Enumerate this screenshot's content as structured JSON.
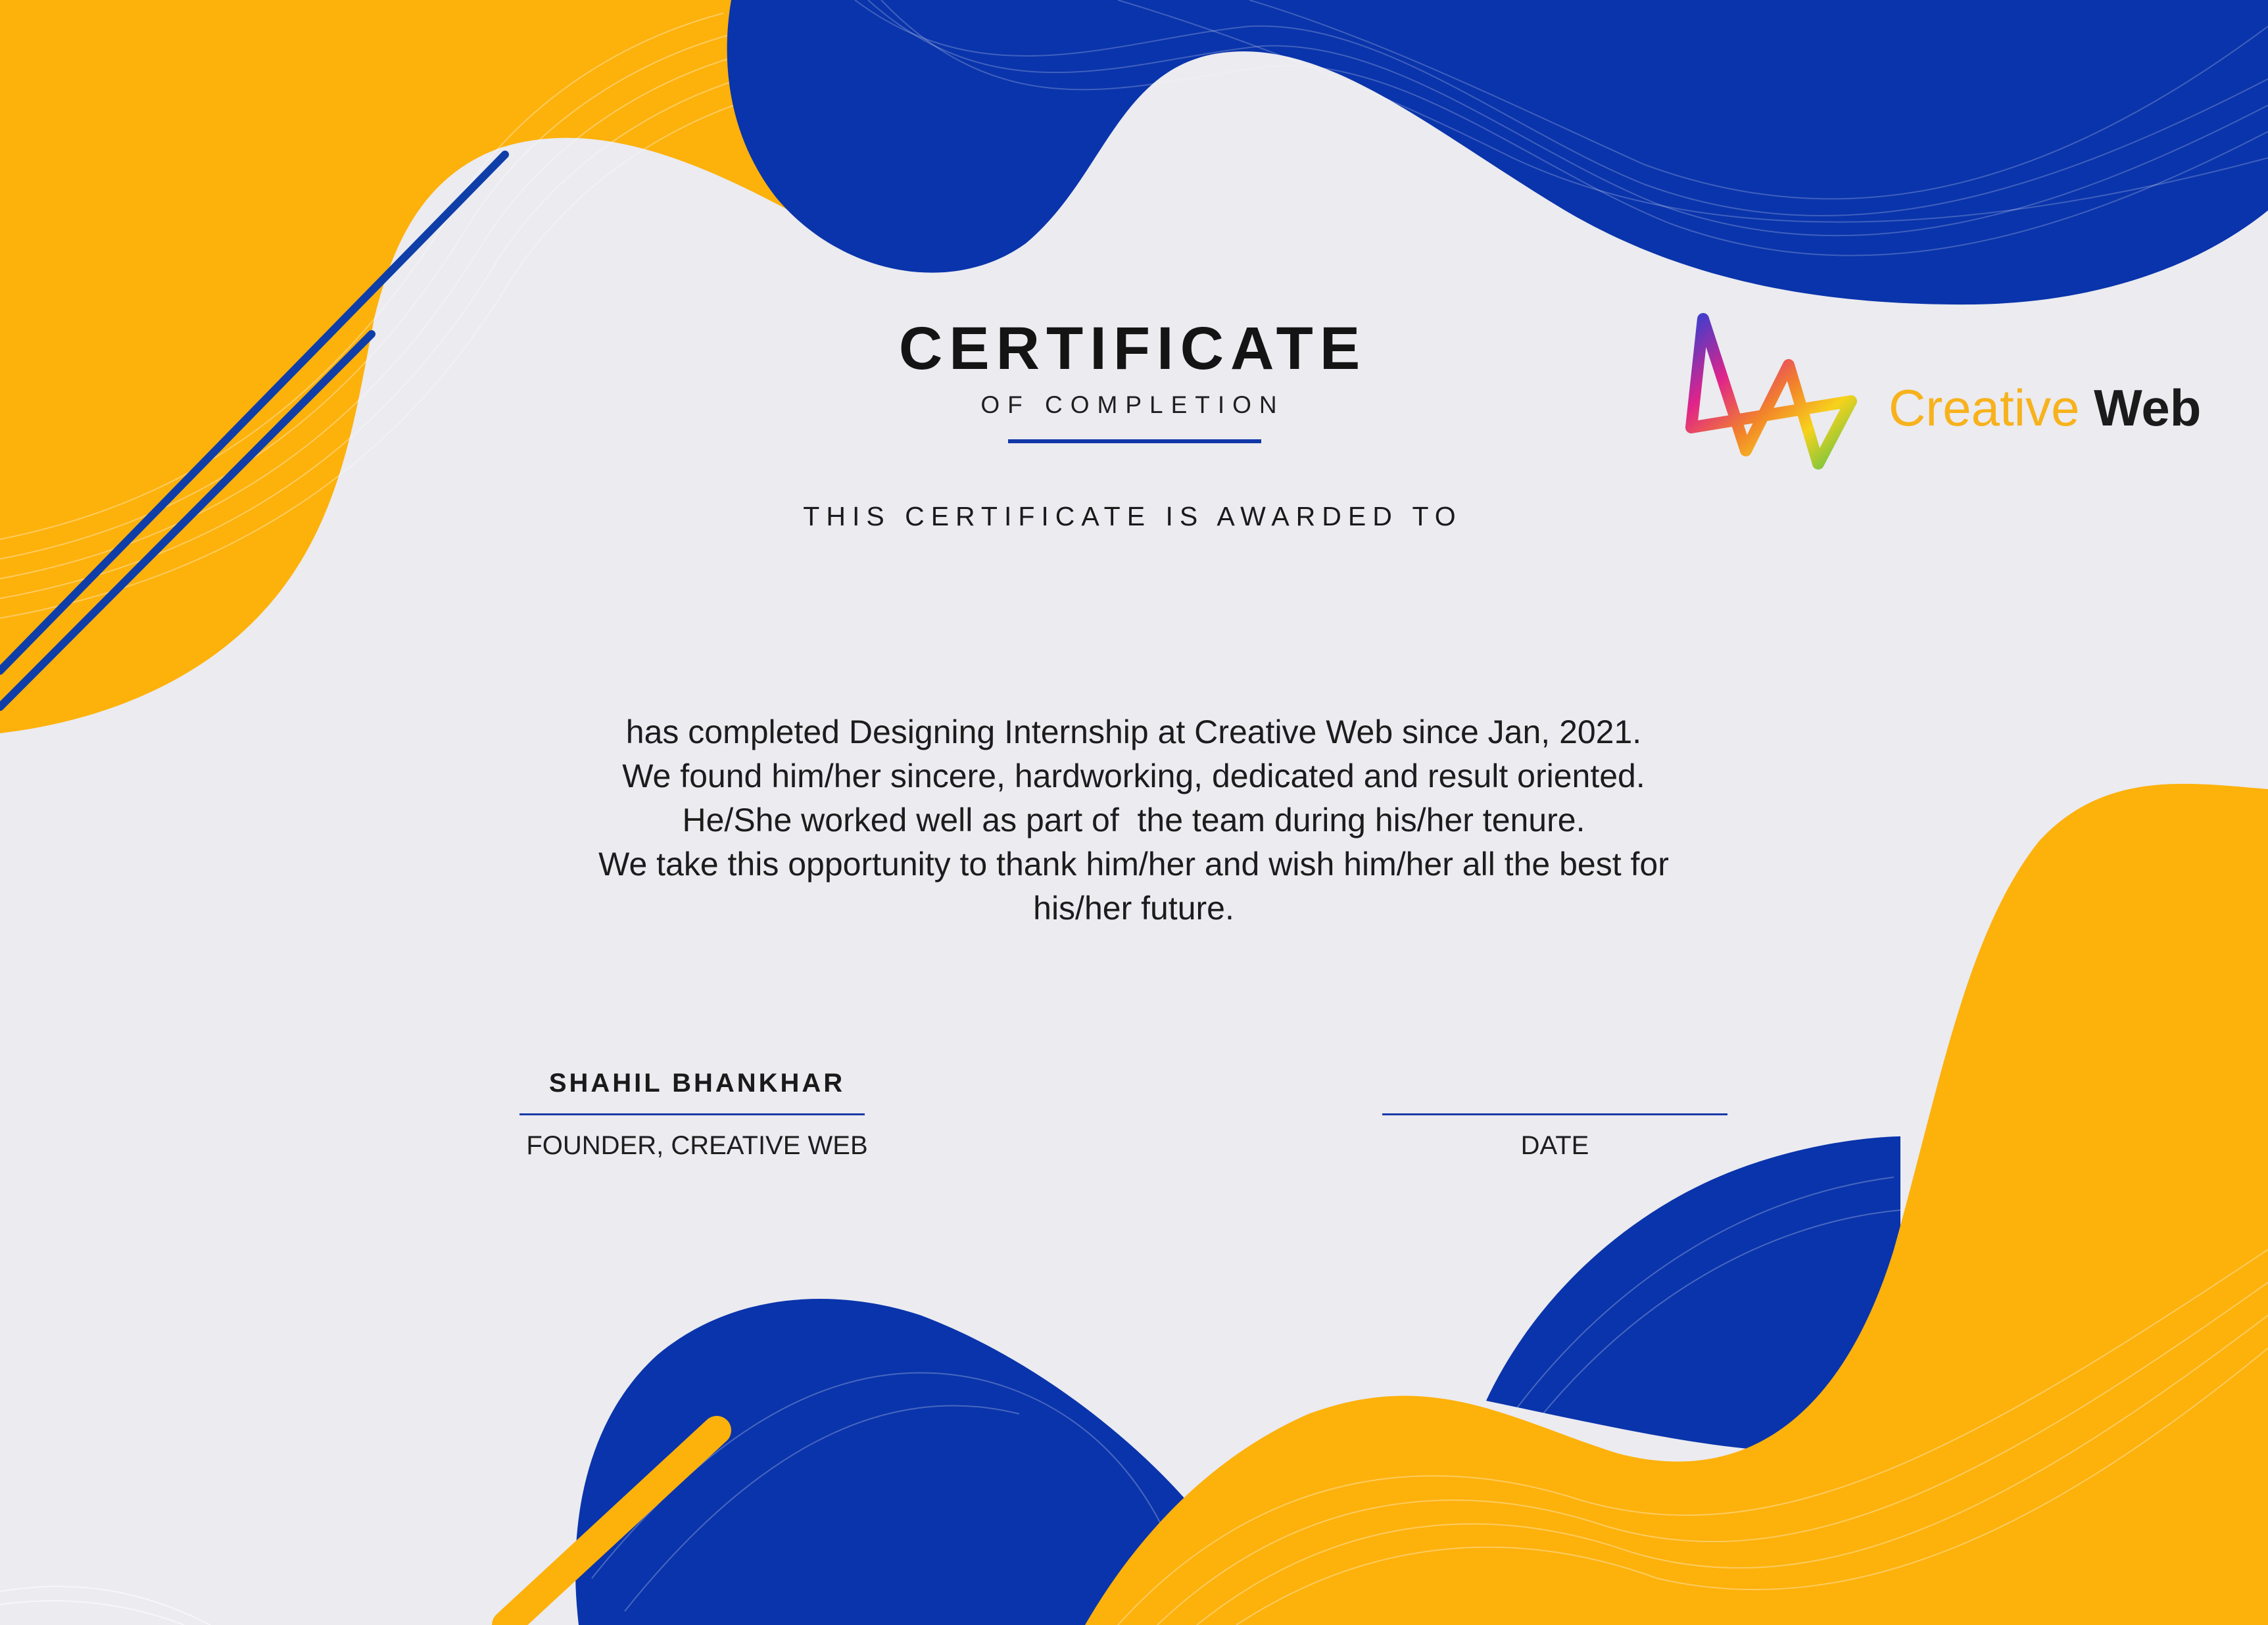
{
  "certificate": {
    "title": "CERTIFICATE",
    "subtitle": "OF COMPLETION",
    "awarded_to_label": "THIS CERTIFICATE IS AWARDED TO",
    "body_lines": [
      "has completed Designing Internship at Creative Web since Jan, 2021.",
      "We found him/her sincere, hardworking, dedicated and result oriented.",
      "He/She worked well as part of  the team during his/her tenure.",
      "We take this opportunity to thank him/her and wish him/her all the best for",
      "his/her future."
    ]
  },
  "brand": {
    "name_part1": "Creative",
    "name_part2": "Web",
    "logo_icon": "zigzag-w-logo-icon"
  },
  "signature": {
    "name": "SHAHIL BHANKHAR",
    "role": "FOUNDER, CREATIVE WEB"
  },
  "date": {
    "label": "DATE"
  },
  "colors": {
    "yellow": "#fdb10b",
    "blue": "#0a34ab",
    "background": "#ebebf0",
    "text": "#141414"
  }
}
